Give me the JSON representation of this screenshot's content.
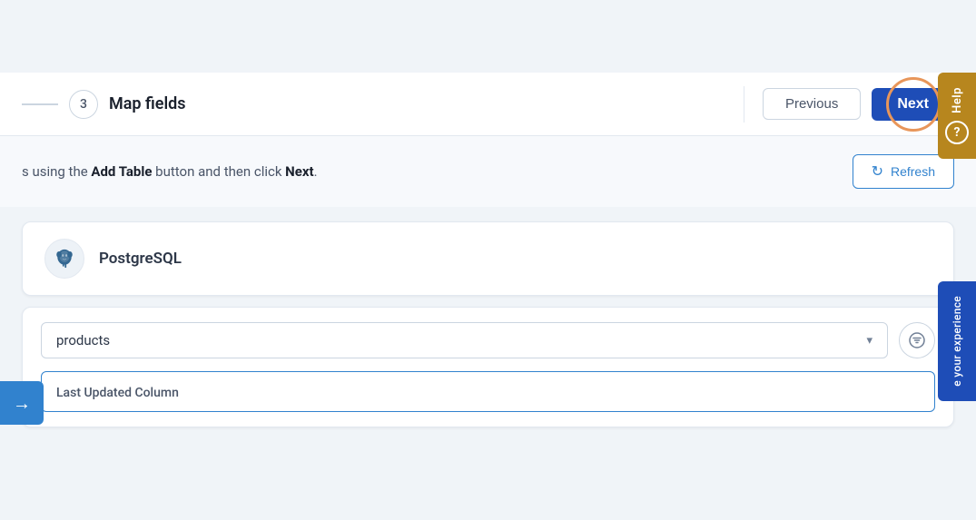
{
  "header": {
    "step_number": "3",
    "step_title": "Map fields",
    "previous_label": "Previous",
    "next_label": "Next"
  },
  "instruction": {
    "text_prefix": "s using the ",
    "bold1": "Add Table",
    "text_mid": " button and then click ",
    "bold2": "Next",
    "text_suffix": ".",
    "refresh_label": "Refresh"
  },
  "database": {
    "name": "PostgreSQL"
  },
  "table": {
    "selected": "products",
    "placeholder": "products"
  },
  "column": {
    "label": "Last Updated Column"
  },
  "help_panel": {
    "label": "Help"
  },
  "experience_panel": {
    "label": "e your experience"
  },
  "icons": {
    "chevron_down": "▾",
    "filter": "⊘",
    "refresh": "↻",
    "arrow_right": "→"
  }
}
